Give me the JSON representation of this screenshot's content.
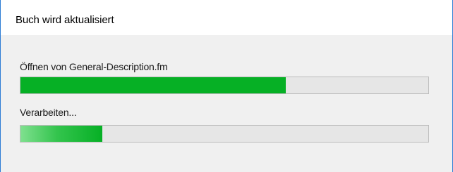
{
  "window": {
    "title": "Buch wird aktualisiert"
  },
  "task_file": {
    "label": "Öffnen von General-Description.fm",
    "progress": 0.65
  },
  "task_processing": {
    "label": "Verarbeiten...",
    "progress": 0.2
  },
  "colors": {
    "progress_fill": "#06b025",
    "progress_track": "#e6e6e6",
    "window_border": "#2b7bd4"
  }
}
